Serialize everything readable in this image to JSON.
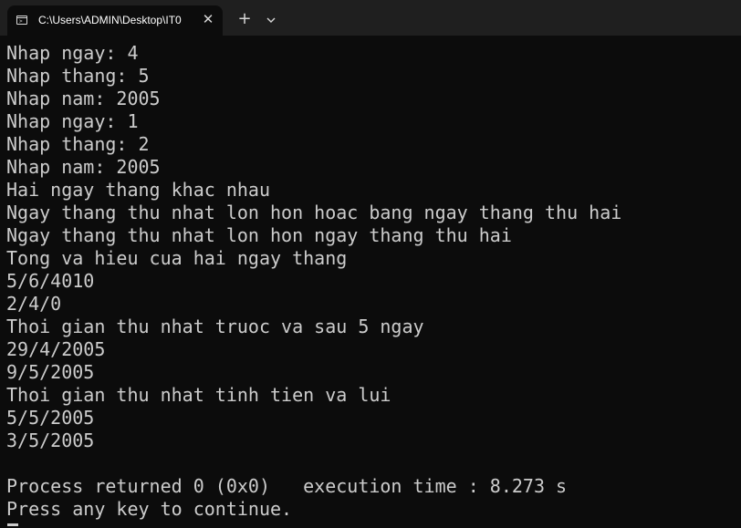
{
  "window": {
    "tab_title": "C:\\Users\\ADMIN\\Desktop\\IT0",
    "tab_close_glyph": "✕",
    "new_tab_glyph": "+",
    "dropdown_icon": "chevron-down-icon",
    "terminal_icon": "terminal-icon"
  },
  "console": {
    "lines": [
      "Nhap ngay: 4",
      "Nhap thang: 5",
      "Nhap nam: 2005",
      "Nhap ngay: 1",
      "Nhap thang: 2",
      "Nhap nam: 2005",
      "Hai ngay thang khac nhau",
      "Ngay thang thu nhat lon hon hoac bang ngay thang thu hai",
      "Ngay thang thu nhat lon hon ngay thang thu hai",
      "Tong va hieu cua hai ngay thang",
      "5/6/4010",
      "2/4/0",
      "Thoi gian thu nhat truoc va sau 5 ngay",
      "29/4/2005",
      "9/5/2005",
      "Thoi gian thu nhat tinh tien va lui",
      "5/5/2005",
      "3/5/2005",
      "",
      "Process returned 0 (0x0)   execution time : 8.273 s",
      "Press any key to continue."
    ]
  },
  "colors": {
    "background": "#0c0c0c",
    "tabbar": "#1f1f1f",
    "text": "#cccccc"
  }
}
